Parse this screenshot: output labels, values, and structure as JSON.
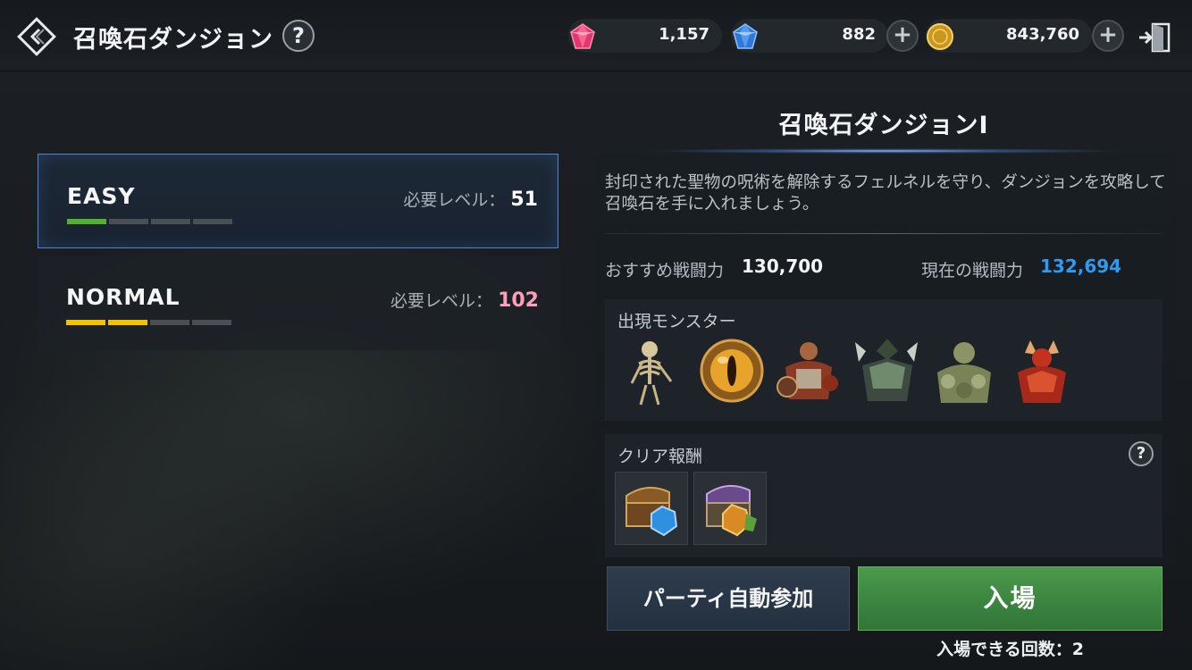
{
  "header": {
    "title": "召喚石ダンジョン",
    "help": "?"
  },
  "currencies": {
    "red_gem": "1,157",
    "blue_gem": "882",
    "gold": "843,760",
    "plus": "+"
  },
  "difficulties": [
    {
      "name": "EASY",
      "req_label": "必要レベル：",
      "req_level": "51",
      "level_color": "#ffffff",
      "progress_filled": 1,
      "progress_total": 4,
      "bar_color": "#52b02e"
    },
    {
      "name": "NORMAL",
      "req_label": "必要レベル：",
      "req_level": "102",
      "level_color": "#ff9eb8",
      "progress_filled": 2,
      "progress_total": 4,
      "bar_color": "#f2c200"
    }
  ],
  "detail": {
    "title": "召喚石ダンジョンⅠ",
    "description": "封印された聖物の呪術を解除するフェルネルを守り、ダンジョンを攻略して召喚石を手に入れましょう。",
    "recommended_label": "おすすめ戦闘力",
    "recommended_value": "130,700",
    "current_label": "現在の戦闘力",
    "current_value": "132,694",
    "current_color": "#2e9bf0",
    "monsters_label": "出現モンスター",
    "monsters": [
      "skeleton-icon",
      "eye-orb-icon",
      "armored-ogre-icon",
      "dark-knight-icon",
      "rock-troll-icon",
      "red-demon-icon"
    ],
    "rewards_label": "クリア報酬",
    "rewards": [
      "treasure-chest-blue-icon",
      "treasure-chest-gold-icon"
    ],
    "rewards_help": "?"
  },
  "actions": {
    "party_button": "パーティ自動参加",
    "enter_button": "入場",
    "enter_count": "入場できる回数：2"
  }
}
